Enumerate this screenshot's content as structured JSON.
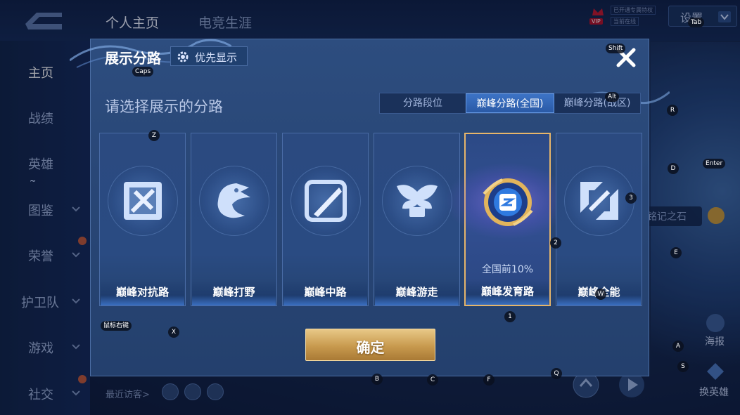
{
  "header": {
    "tabs": [
      "个人主页",
      "电竞生涯"
    ],
    "vip_badge": "VIP",
    "mini_tags": [
      "已开通专属特权",
      "当前在线"
    ],
    "settings_label": "设置"
  },
  "sidebar": {
    "items": [
      {
        "label": "主页",
        "active": true
      },
      {
        "label": "战绩"
      },
      {
        "label": "英雄"
      },
      {
        "label": "图鉴"
      },
      {
        "label": "荣誉"
      },
      {
        "label": "护卫队"
      },
      {
        "label": "游戏"
      },
      {
        "label": "社交"
      }
    ]
  },
  "right_panel": {
    "stone_label": "铭记之石",
    "poster_label": "海报",
    "swap_hero_label": "换英雄"
  },
  "footer": {
    "visitors_label": "最近访客>"
  },
  "modal": {
    "title": "展示分路",
    "priority_label": "优先显示",
    "subtitle": "请选择展示的分路",
    "segments": [
      "分路段位",
      "巅峰分路(全国)",
      "巅峰分路(战区)"
    ],
    "active_segment": 1,
    "cards": [
      {
        "label": "巅峰对抗路",
        "icon": "sword-shield-icon"
      },
      {
        "label": "巅峰打野",
        "icon": "dragon-icon"
      },
      {
        "label": "巅峰中路",
        "icon": "staff-icon"
      },
      {
        "label": "巅峰游走",
        "icon": "wings-icon"
      },
      {
        "label": "巅峰发育路",
        "icon": "marksman-emblem-icon",
        "rank": "全国前10%",
        "selected": true
      },
      {
        "label": "巅峰全能",
        "icon": "allround-icon"
      }
    ],
    "confirm_label": "确定"
  },
  "key_hints": {
    "shift": "Shift",
    "caps": "Caps",
    "alt": "Alt",
    "tab": "Tab",
    "enter": "Enter",
    "mouse_right": "鼠标右键",
    "tilde": "~",
    "z": "Z",
    "x": "X",
    "r": "R",
    "d": "D",
    "e": "E",
    "a": "A",
    "s": "S",
    "b": "B",
    "c": "C",
    "f": "F",
    "q": "Q",
    "w": "W",
    "n1": "1",
    "n2": "2",
    "n3": "3"
  },
  "colors": {
    "accent_gold": "#e6b56a",
    "segment_active": "#3d74c6",
    "modal_bg": "#2d4d7f"
  }
}
